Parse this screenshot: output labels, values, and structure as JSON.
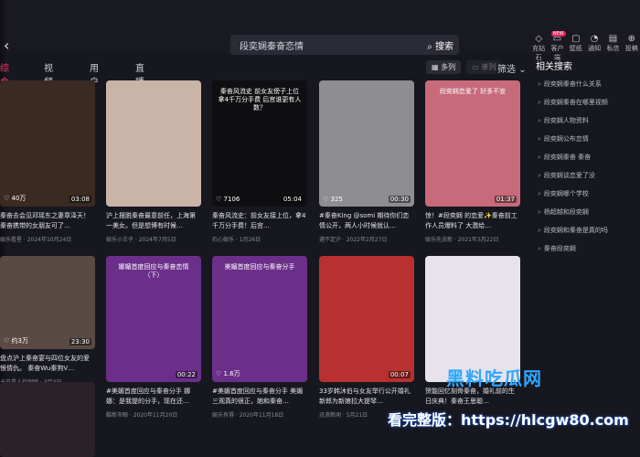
{
  "search": {
    "query": "段奕娴秦奋恋情",
    "button": "搜索"
  },
  "top_icons": [
    {
      "label": "充钻石",
      "icon": "diamond-icon"
    },
    {
      "label": "客户端",
      "icon": "download-icon",
      "badge": "NEW"
    },
    {
      "label": "壁纸",
      "icon": "wallpaper-icon"
    },
    {
      "label": "通知",
      "icon": "bell-icon"
    },
    {
      "label": "私信",
      "icon": "message-icon"
    },
    {
      "label": "投稿",
      "icon": "upload-icon"
    }
  ],
  "tabs": [
    {
      "label": "综合",
      "active": true
    },
    {
      "label": "视频",
      "active": false
    },
    {
      "label": "用户",
      "active": false
    },
    {
      "label": "直播",
      "active": false
    }
  ],
  "view": {
    "grid": "多列",
    "single": "单列",
    "sort": "筛选"
  },
  "related": {
    "title": "相关搜索",
    "items": [
      "段奕娴秦奋什么关系",
      "段奕娴秦奋在哪里视频",
      "段奕娴人物资料",
      "段奕娴公布恋情",
      "段奕娴秦奋 秦奋",
      "段奕娴谈恋爱了没",
      "段奕娴哪个学校",
      "杨超越和段奕娴",
      "段奕娴和秦奋是真的吗",
      "秦奋段奕娴"
    ]
  },
  "cards": [
    {
      "likes": "40万",
      "duration": "03:08",
      "title": "秦奋去会见邓瑶东之妻章泽天！秦奋携带的女朋友可了…",
      "meta": "娱乐看星 · 2024年10月24日",
      "bg": "#3a2a22",
      "overlay": ""
    },
    {
      "likes": "",
      "duration": "",
      "title": "沪上摆脱秦奋最意前任，上海第一美女。但是想博有时候…",
      "meta": "娱乐小王子 · 2024年7月5日",
      "bg": "#c9b4a8",
      "overlay": ""
    },
    {
      "likes": "7106",
      "duration": "05:04",
      "title": "秦奋风流史：前女友接上位，拿4千万分手费！后宫…",
      "meta": "石心娱乐 · 1月26日",
      "bg": "#0f0f12",
      "overlay": "秦奋风流史 前女友傍子上位拿4千万分手费 后宫谁更有人数？"
    },
    {
      "likes": "325",
      "duration": "00:30",
      "title": "#秦奋King @somi 期待你们恋情公开，两人小时候就认…",
      "meta": "遵不定沪 · 2022年2月27日",
      "bg": "#8d8d92",
      "overlay": ""
    },
    {
      "likes": "",
      "duration": "01:37",
      "title": "惊！#段奕娴 的恋爱✨秦奋前工作人员爆料了 大激给…",
      "meta": "娱乐先说新 · 2021年3月22日",
      "bg": "#c76a7a",
      "overlay": "段奕娴恋爱了 好多不宣"
    },
    {
      "likes": "约3万",
      "duration": "23:30",
      "title": "盘点沪上秦奋宴与四位女友的爱恨情仇。 秦奋Wu秦狗V…",
      "meta": "卡贝拿人伦国国 · 3月3日",
      "bg": "#5a4a44",
      "overlay": ""
    },
    {
      "likes": "",
      "duration": "00:22",
      "title": "#美媚首度回应与秦奋分手 娜娜：是我提的分手，现在还…",
      "meta": "酷新市眼 · 2020年11月20日",
      "bg": "#6b2f8a",
      "overlay": "娜媚首度回应与秦奋恋情（下）"
    },
    {
      "likes": "1.6万",
      "duration": "",
      "title": "#美媚首度回应与秦奋分手 美媚三观真的很正，她和秦奋…",
      "meta": "娱乐有得 · 2020年11月18日",
      "bg": "#6b2f8a",
      "overlay": "美媚首度回应与秦奋分手"
    },
    {
      "likes": "",
      "duration": "00:07",
      "title": "33岁韩沐伯与女友举行公开婚礼 新郎为新娘拉大提琴…",
      "meta": "迅浪新闻 · 5月21日",
      "bg": "#b83030",
      "overlay": ""
    },
    {
      "likes": "",
      "duration": "",
      "title": "贺能回忆刻骨秦奋，婚礼前的生日庆典！秦奋王思聪…",
      "meta": "",
      "bg": "#e8e2ea",
      "overlay": ""
    }
  ],
  "watermark": {
    "brand": "黑料吃瓜网",
    "line": "看完整版：https://hlcgw80.com"
  }
}
